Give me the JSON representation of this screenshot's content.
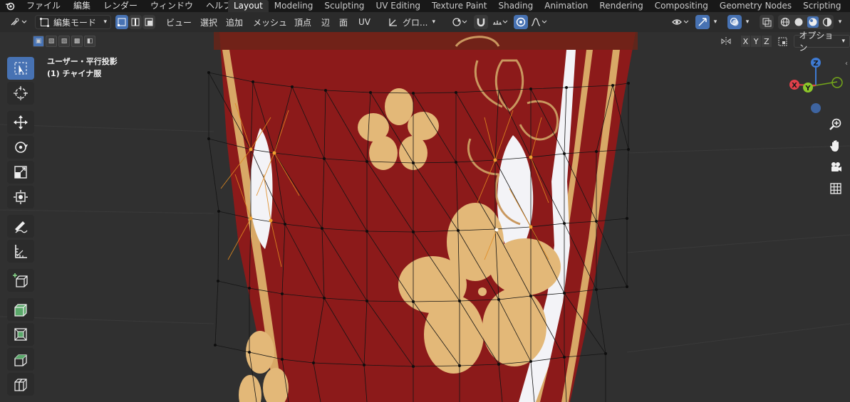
{
  "topbar": {
    "menu": [
      "ファイル",
      "編集",
      "レンダー",
      "ウィンドウ",
      "ヘルプ"
    ],
    "workspaces": [
      "Layout",
      "Modeling",
      "Sculpting",
      "UV Editing",
      "Texture Paint",
      "Shading",
      "Animation",
      "Rendering",
      "Compositing",
      "Geometry Nodes",
      "Scripting"
    ],
    "active_workspace": "Layout",
    "add_label": "+"
  },
  "header": {
    "mode_label": "編集モード",
    "menus": [
      "ビュー",
      "選択",
      "追加",
      "メッシュ",
      "頂点",
      "辺",
      "面",
      "UV"
    ],
    "transform_label": "グロ...",
    "options_label": "オプション",
    "axis_x": "X",
    "axis_y": "Y",
    "axis_z": "Z"
  },
  "viewport": {
    "view_name": "ユーザー・平行投影",
    "object_name": "(1) チャイナ服"
  },
  "gizmo": {
    "x_label": "X",
    "y_label": "Y",
    "z_label": "Z",
    "x_color": "#e0404a",
    "y_color": "#74a61a",
    "z_color": "#3e7ad2"
  },
  "colors": {
    "fabric": "#8c1a1a",
    "petal": "#e3b878",
    "selected_vertex": "#f0a030",
    "accent": "#4772b3"
  },
  "icons": {
    "toolbar": [
      "select-box-icon",
      "cursor-icon",
      "move-icon",
      "rotate-icon",
      "scale-icon",
      "transform-icon",
      "annotate-icon",
      "measure-icon",
      "add-cube-icon",
      "extrude-icon",
      "inset-icon",
      "bevel-icon",
      "loop-cut-icon"
    ],
    "nav": [
      "zoom-icon",
      "pan-icon",
      "camera-icon",
      "grid-icon"
    ]
  }
}
